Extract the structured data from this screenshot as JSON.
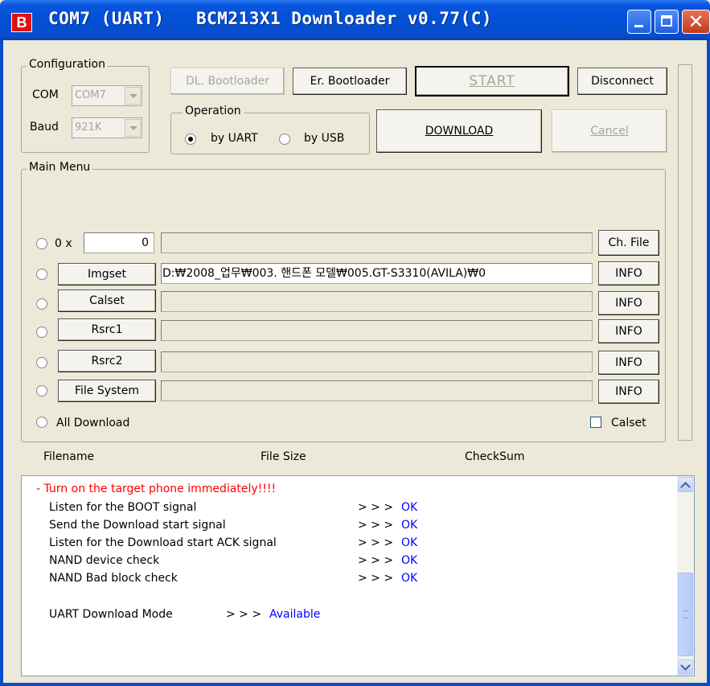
{
  "window": {
    "title": "COM7 (UART)   BCM213X1 Downloader v0.77(C)",
    "icon_letter": "B"
  },
  "configuration": {
    "legend": "Configuration",
    "com_label": "COM",
    "com_value": "COM7",
    "baud_label": "Baud",
    "baud_value": "921K"
  },
  "toolbar": {
    "dl_bootloader": "DL. Bootloader",
    "er_bootloader": "Er. Bootloader",
    "start": "START",
    "disconnect": "Disconnect",
    "download": "DOWNLOAD",
    "cancel": "Cancel"
  },
  "operation": {
    "legend": "Operation",
    "by_uart": "by UART",
    "by_usb": "by USB",
    "selected": "by UART"
  },
  "main_menu": {
    "legend": "Main Menu",
    "hex_prefix": "0 x",
    "hex_value": "0",
    "ch_file": "Ch. File",
    "rows": [
      {
        "label": "Imgset",
        "path": "D:₩2008_업무₩003. 핸드폰 모델₩005.GT-S3310(AVILA)₩0",
        "info": "INFO"
      },
      {
        "label": "Calset",
        "path": "",
        "info": "INFO"
      },
      {
        "label": "Rsrc1",
        "path": "",
        "info": "INFO"
      },
      {
        "label": "Rsrc2",
        "path": "",
        "info": "INFO"
      },
      {
        "label": "File System",
        "path": "",
        "info": "INFO"
      }
    ],
    "all_download": "All Download",
    "calset_check": "Calset"
  },
  "columns": {
    "filename": "Filename",
    "file_size": "File Size",
    "checksum": "CheckSum"
  },
  "log": {
    "warning": "- Turn on the target phone immediately!!!!",
    "lines": [
      {
        "text": "Listen for the BOOT signal",
        "arrow": "> > >",
        "status": "OK"
      },
      {
        "text": "Send the Download start signal",
        "arrow": "> > >",
        "status": "OK"
      },
      {
        "text": "Listen for the Download start ACK signal",
        "arrow": "> > >",
        "status": "OK"
      },
      {
        "text": "NAND device check",
        "arrow": "> > >",
        "status": "OK"
      },
      {
        "text": "NAND Bad block check",
        "arrow": "> > >",
        "status": "OK"
      }
    ],
    "mode_label": "UART Download Mode",
    "mode_arrow": "> > >",
    "mode_status": "Available"
  },
  "colors": {
    "title_bar": "#0a4dcc",
    "warning_text": "#ff0000",
    "status_text": "#0000ff"
  }
}
